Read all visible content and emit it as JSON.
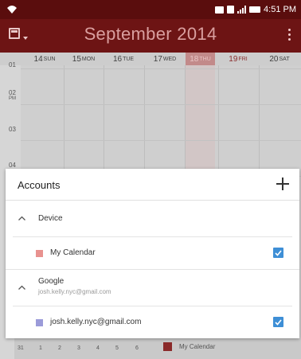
{
  "status_bar": {
    "time": "4:51 PM"
  },
  "toolbar": {
    "title": "September 2014"
  },
  "week": {
    "days": [
      {
        "num": "14",
        "wd": "SUN"
      },
      {
        "num": "15",
        "wd": "MON"
      },
      {
        "num": "16",
        "wd": "TUE"
      },
      {
        "num": "17",
        "wd": "WED"
      },
      {
        "num": "18",
        "wd": "THU"
      },
      {
        "num": "19",
        "wd": "FRI"
      },
      {
        "num": "20",
        "wd": "SAT"
      }
    ],
    "today_index": 4
  },
  "hours": [
    {
      "hour": "01",
      "ampm": ""
    },
    {
      "hour": "02",
      "ampm": "PM"
    },
    {
      "hour": "03",
      "ampm": ""
    },
    {
      "hour": "04",
      "ampm": ""
    }
  ],
  "accounts": {
    "title": "Accounts",
    "groups": [
      {
        "name": "Device",
        "subtitle": "",
        "calendars": [
          {
            "name": "My Calendar",
            "color": "#e8928f",
            "checked": true
          }
        ]
      },
      {
        "name": "Google",
        "subtitle": "josh.kelly.nyc@gmail.com",
        "calendars": [
          {
            "name": "josh.kelly.nyc@gmail.com",
            "color": "#9b9bd9",
            "checked": true
          }
        ]
      }
    ]
  },
  "month_strip": {
    "days": [
      "31",
      "1",
      "2",
      "3",
      "4",
      "5",
      "6"
    ]
  },
  "bottom_event": {
    "name": "My Calendar",
    "color": "#8a2a2a"
  },
  "colors": {
    "status_bar": "#5a0d0d",
    "toolbar": "#6d1414",
    "checkbox": "#3e8fd6"
  }
}
